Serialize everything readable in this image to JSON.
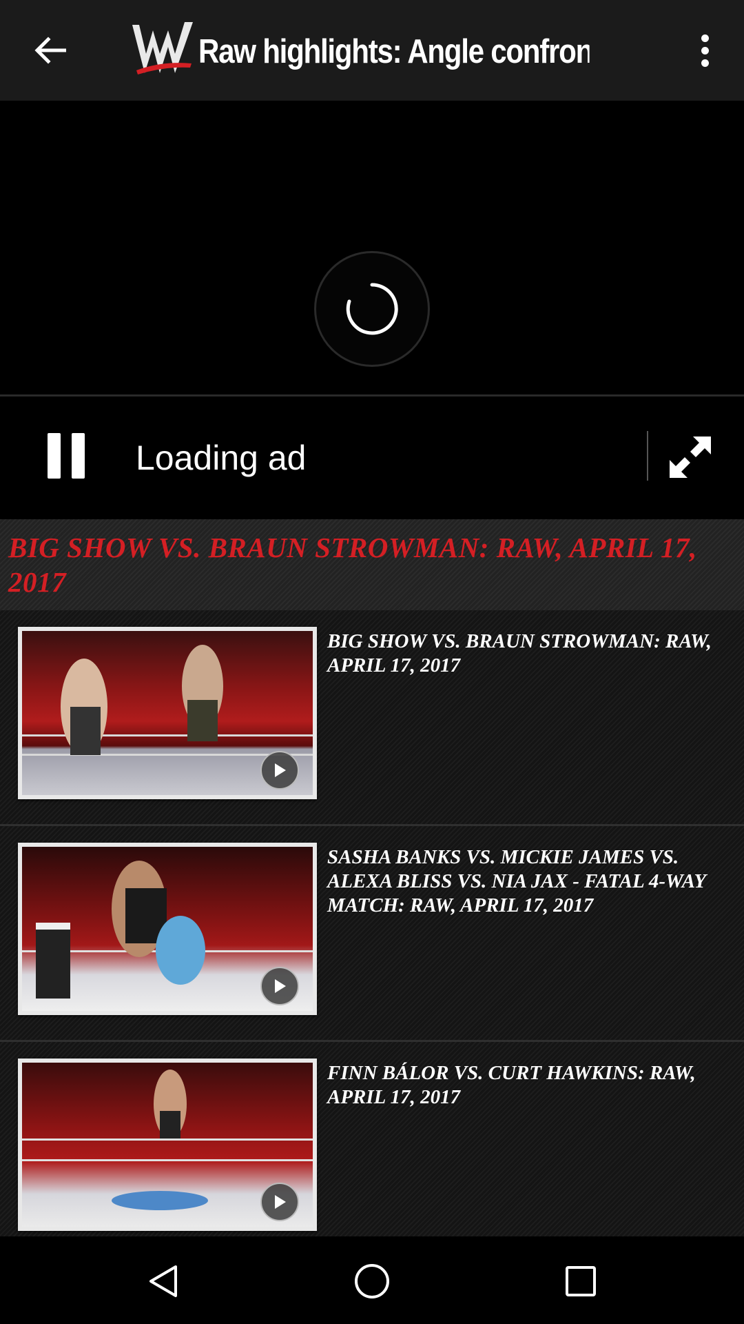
{
  "appbar": {
    "title": "Raw highlights: Angle confronts Strow…",
    "back_icon": "arrow-left-icon",
    "more_icon": "more-vert-icon",
    "logo_icon": "wwe-logo-icon"
  },
  "player": {
    "loading_label": "Loading ad",
    "spinner_icon": "loading-spinner-icon",
    "pause_icon": "pause-icon",
    "fullscreen_icon": "fullscreen-expand-icon"
  },
  "section": {
    "title": "BIG SHOW VS. BRAUN STROWMAN: RAW, APRIL 17, 2017"
  },
  "videos": [
    {
      "title": "BIG SHOW VS. BRAUN STROWMAN: RAW, APRIL 17, 2017"
    },
    {
      "title": "SASHA BANKS VS. MICKIE JAMES VS. ALEXA BLISS VS. NIA JAX - FATAL 4-WAY MATCH: RAW, APRIL 17, 2017"
    },
    {
      "title": "FINN BÁLOR VS. CURT HAWKINS: RAW, APRIL 17, 2017"
    }
  ],
  "navbar": {
    "back_icon": "nav-back-triangle-icon",
    "home_icon": "nav-home-circle-icon",
    "recents_icon": "nav-recents-square-icon"
  },
  "colors": {
    "accent_red": "#d41f24",
    "appbar_bg": "#1b1b1b"
  }
}
